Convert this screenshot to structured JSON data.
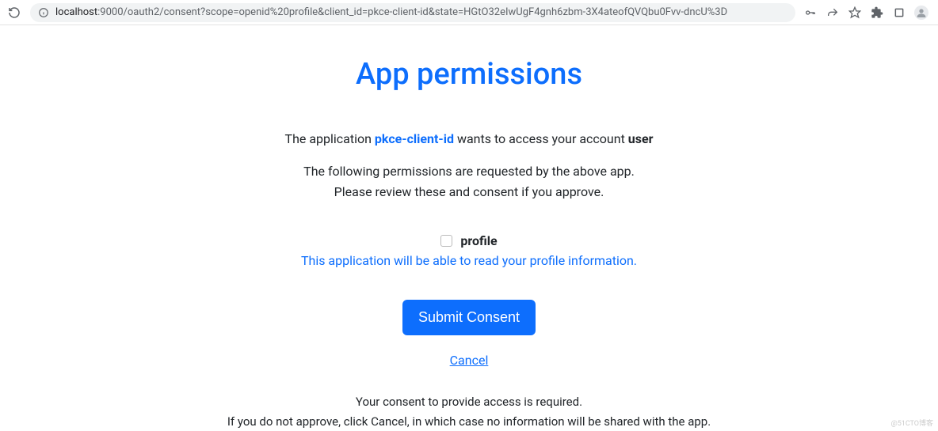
{
  "browser": {
    "url_host": "localhost",
    "url_path": ":9000/oauth2/consent?scope=openid%20profile&client_id=pkce-client-id&state=HGtO32eIwUgF4gnh6zbm-3X4ateofQVQbu0Fvv-dncU%3D"
  },
  "page": {
    "title": "App permissions",
    "intro_prefix": "The application ",
    "client_id": "pkce-client-id",
    "intro_mid": " wants to access your account ",
    "username": "user",
    "sub_line1": "The following permissions are requested by the above app.",
    "sub_line2": "Please review these and consent if you approve.",
    "scopes": [
      {
        "name": "profile",
        "description": "This application will be able to read your profile information."
      }
    ],
    "submit_label": "Submit Consent",
    "cancel_label": "Cancel",
    "footer_line1": "Your consent to provide access is required.",
    "footer_line2": "If you do not approve, click Cancel, in which case no information will be shared with the app."
  },
  "watermark": "@51CTO博客"
}
